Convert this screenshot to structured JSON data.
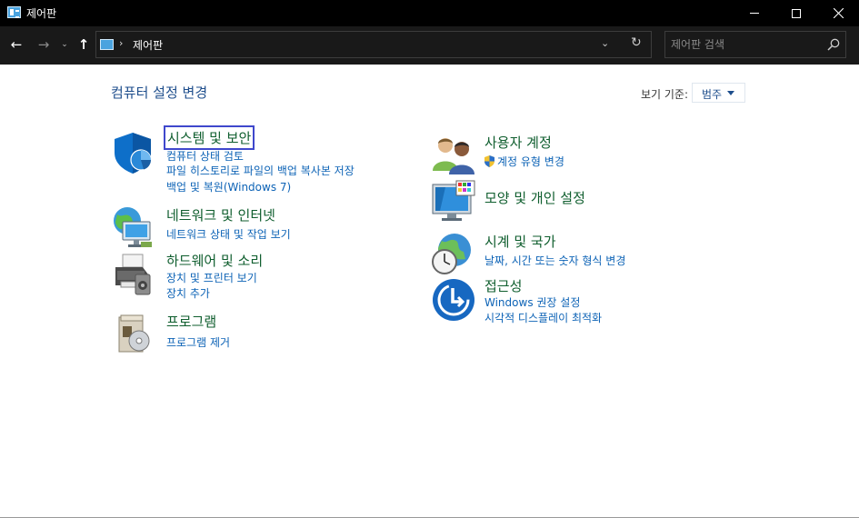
{
  "window": {
    "title": "제어판"
  },
  "nav": {
    "back": "←",
    "forward": "→",
    "recent": "⌄",
    "up": "↑",
    "address": {
      "separator": "›",
      "crumb": "제어판",
      "dropdown": "⌄",
      "refresh": "↻"
    },
    "search": {
      "placeholder": "제어판 검색"
    }
  },
  "content": {
    "title": "컴퓨터 설정 변경",
    "view_by_label": "보기 기준:",
    "view_by_value": "범주"
  },
  "categories_left": [
    {
      "heading": "시스템 및 보안",
      "links": [
        "컴퓨터 상태 검토",
        "파일 히스토리로 파일의 백업 복사본 저장",
        "백업 및 복원(Windows 7)"
      ]
    },
    {
      "heading": "네트워크 및 인터넷",
      "links": [
        "네트워크 상태 및 작업 보기"
      ]
    },
    {
      "heading": "하드웨어 및 소리",
      "links": [
        "장치 및 프린터 보기",
        "장치 추가"
      ]
    },
    {
      "heading": "프로그램",
      "links": [
        "프로그램 제거"
      ]
    }
  ],
  "categories_right": [
    {
      "heading": "사용자 계정",
      "links": [
        "계정 유형 변경"
      ]
    },
    {
      "heading": "모양 및 개인 설정",
      "links": []
    },
    {
      "heading": "시계 및 국가",
      "links": [
        "날짜, 시간 또는 숫자 형식 변경"
      ]
    },
    {
      "heading": "접근성",
      "links": [
        "Windows 권장 설정",
        "시각적 디스플레이 최적화"
      ]
    }
  ],
  "colors": {
    "titlebar": "#000000",
    "navbar": "#191919",
    "heading": "#0f5e2e",
    "link": "#0d63b6",
    "focus": "#3f48cc"
  }
}
